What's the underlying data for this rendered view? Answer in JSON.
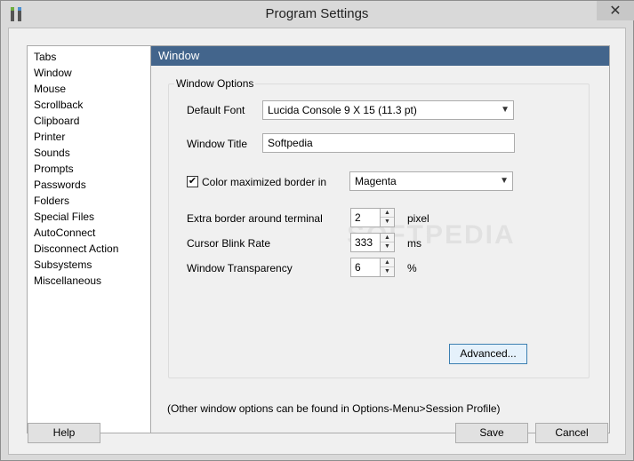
{
  "window": {
    "title": "Program Settings"
  },
  "sidebar": {
    "items": [
      {
        "label": "Tabs"
      },
      {
        "label": "Window"
      },
      {
        "label": "Mouse"
      },
      {
        "label": "Scrollback"
      },
      {
        "label": "Clipboard"
      },
      {
        "label": "Printer"
      },
      {
        "label": "Sounds"
      },
      {
        "label": "Prompts"
      },
      {
        "label": "Passwords"
      },
      {
        "label": "Folders"
      },
      {
        "label": "Special Files"
      },
      {
        "label": "AutoConnect"
      },
      {
        "label": "Disconnect Action"
      },
      {
        "label": "Subsystems"
      },
      {
        "label": "Miscellaneous"
      }
    ],
    "selected": "Window"
  },
  "panel": {
    "header": "Window",
    "group_label": "Window Options",
    "default_font_label": "Default Font",
    "default_font_value": "Lucida Console  9 X 15 (11.3 pt)",
    "window_title_label": "Window Title",
    "window_title_value": "Softpedia",
    "color_border_label": "Color maximized border in",
    "color_border_checked": "✔",
    "color_border_value": "Magenta",
    "extra_border_label": "Extra border around terminal",
    "extra_border_value": "2",
    "extra_border_unit": "pixel",
    "cursor_blink_label": "Cursor Blink Rate",
    "cursor_blink_value": "333",
    "cursor_blink_unit": "ms",
    "transparency_label": "Window Transparency",
    "transparency_value": "6",
    "transparency_unit": "%",
    "advanced_label": "Advanced...",
    "footnote": "(Other window options can be found in Options-Menu>Session Profile)"
  },
  "buttons": {
    "help": "Help",
    "save": "Save",
    "cancel": "Cancel"
  },
  "watermark": "SOFTPEDIA"
}
